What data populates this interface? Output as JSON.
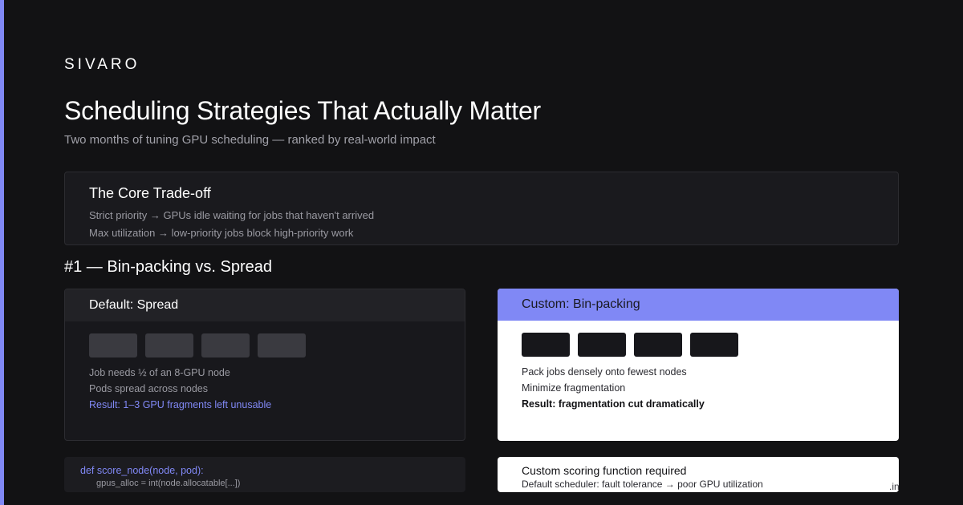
{
  "brand": "SIVARO",
  "title": "Scheduling Strategies That Actually Matter",
  "subtitle": "Two months of tuning GPU scheduling — ranked by real-world impact",
  "core": {
    "heading": "The Core Trade-off",
    "line1": "Strict priority → GPUs idle waiting for jobs that haven't arrived",
    "line2": "Max utilization → low-priority jobs block high-priority work"
  },
  "section_title": "#1 — Bin-packing vs. Spread",
  "spread_card": {
    "heading": "Default: Spread",
    "line1": "Job needs ½ of an 8-GPU node",
    "line2": "Pods spread across nodes",
    "result": "Result: 1–3 GPU fragments left unusable"
  },
  "binpack_card": {
    "heading": "Custom: Bin-packing",
    "line1": "Pack jobs densely onto fewest nodes",
    "line2": "Minimize fragmentation",
    "result": "Result: fragmentation cut dramatically"
  },
  "code": {
    "line1": "def score_node(node, pod):",
    "line2": "gpus_alloc = int(node.allocatable[...])"
  },
  "note": {
    "heading": "Custom scoring function required",
    "line": "Default scheduler: fault tolerance → poor GPU utilization"
  },
  "watermark": ".in",
  "colors": {
    "accent": "#8088f5",
    "background": "#121214",
    "panel": "#1a1a1e"
  }
}
